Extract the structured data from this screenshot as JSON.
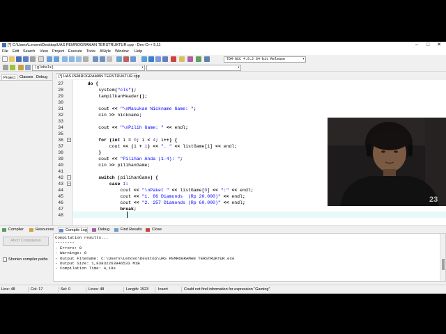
{
  "window": {
    "title": "[*] C:\\Users\\Lenovo\\Desktop\\UAS PEMROGRAMAN TERSTRUKTUR.cpp - Dev-C++ 5.11",
    "minimize": "–",
    "maximize": "□",
    "close": "✕"
  },
  "menu": [
    "File",
    "Edit",
    "Search",
    "View",
    "Project",
    "Execute",
    "Tools",
    "AStyle",
    "Window",
    "Help"
  ],
  "toolbar": {
    "compiler_select": "TDM-GCC 4.9.2 64-bit Release",
    "globals_select": "(globals)"
  },
  "panel_tabs": [
    "Project",
    "Classes",
    "Debug"
  ],
  "editor_tab": "[*] UAS PEMROGRAMAN TERSTRUKTUR.cpp",
  "code": [
    {
      "n": "27",
      "text": "    do {"
    },
    {
      "n": "28",
      "text": "        system(\"cls\");"
    },
    {
      "n": "29",
      "text": "        tampilkanHeader();"
    },
    {
      "n": "30",
      "text": ""
    },
    {
      "n": "31",
      "text": "        cout << \"\\nMasukan Nickname Game: \";"
    },
    {
      "n": "32",
      "text": "        cin >> nickname;"
    },
    {
      "n": "33",
      "text": ""
    },
    {
      "n": "34",
      "text": "        cout << \"\\nPilih Game: \" << endl;"
    },
    {
      "n": "35",
      "text": ""
    },
    {
      "n": "36",
      "text": "        for (int i = 0; i < 4; i++) {"
    },
    {
      "n": "37",
      "text": "            cout << (i + 1) << \". \" << listGame[i] << endl;"
    },
    {
      "n": "38",
      "text": "        }"
    },
    {
      "n": "39",
      "text": "        cout << \"Pilihan Anda (1-4): \";"
    },
    {
      "n": "40",
      "text": "        cin >> pilihanGame;"
    },
    {
      "n": "41",
      "text": ""
    },
    {
      "n": "42",
      "text": "        switch (pilihanGame) {"
    },
    {
      "n": "43",
      "text": "            case 1:"
    },
    {
      "n": "44",
      "text": "                cout << \"\\nPaket \" << listGame[0] << \":\" << endl;"
    },
    {
      "n": "45",
      "text": "                cout << \"1. 86 Diamonds  (Rp 20.000)\" << endl;"
    },
    {
      "n": "46",
      "text": "                cout << \"2. 257 Diamonds (Rp 60.000)\" << endl;"
    },
    {
      "n": "47",
      "text": "                break;"
    },
    {
      "n": "48",
      "text": ""
    }
  ],
  "bottom_tabs": [
    "Compiler",
    "Resources",
    "Compile Log",
    "Debug",
    "Find Results",
    "Close"
  ],
  "abort_button": "Abort Compilation",
  "shorten_paths": "Shorten compiler paths",
  "log": [
    "Compilation results...",
    "--------",
    "- Errors: 0",
    "- Warnings: 0",
    "- Output Filename: C:\\Users\\Lenovo\\Desktop\\UAS PEMROGRAMAN TERSTRUKTUR.exe",
    "- Output Size: 1,83832263946533 MiB",
    "- Compilation Time: 4,19s"
  ],
  "status": {
    "line": "Line:   48",
    "col": "Col:   17",
    "sel": "Sel:   0",
    "lines": "Lines:   48",
    "length": "Length:  1523",
    "mode": "Insert",
    "message": "Could not find information for expression \"Gaming\""
  }
}
